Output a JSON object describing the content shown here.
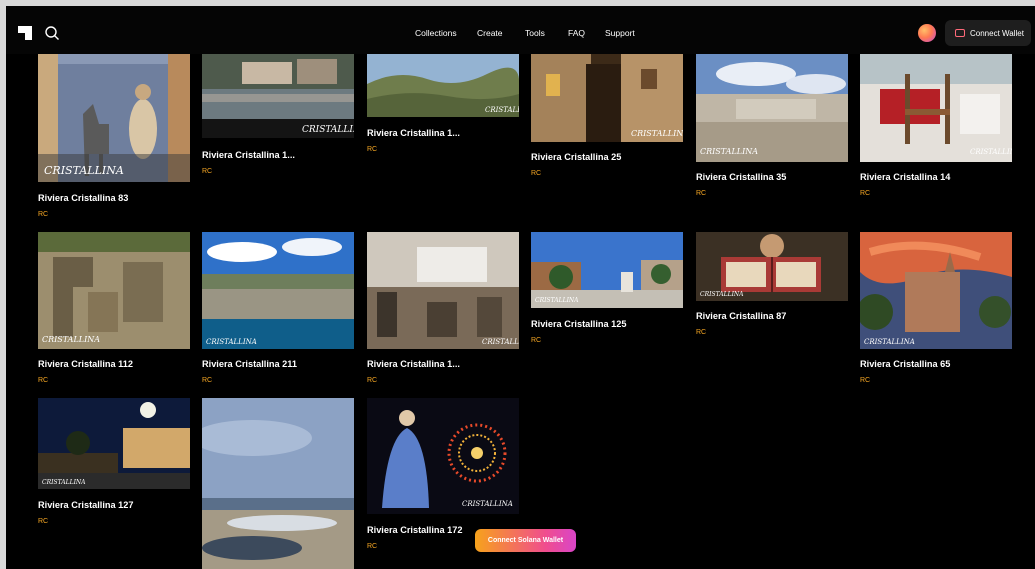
{
  "nav": {
    "links": [
      "Collections",
      "Create",
      "Tools",
      "FAQ",
      "Support"
    ],
    "connect_wallet": "Connect Wallet"
  },
  "watermark": "CRISTALLINA",
  "cards": [
    {
      "title": "Riviera Cristallina 83",
      "sub": "RC"
    },
    {
      "title": "Riviera Cristallina 1...",
      "sub": "RC"
    },
    {
      "title": "Riviera Cristallina 1...",
      "sub": "RC"
    },
    {
      "title": "Riviera Cristallina 25",
      "sub": "RC"
    },
    {
      "title": "Riviera Cristallina 35",
      "sub": "RC"
    },
    {
      "title": "Riviera Cristallina 14",
      "sub": "RC"
    },
    {
      "title": "Riviera Cristallina 112",
      "sub": "RC"
    },
    {
      "title": "Riviera Cristallina 211",
      "sub": "RC"
    },
    {
      "title": "Riviera Cristallina 1...",
      "sub": "RC"
    },
    {
      "title": "Riviera Cristallina 125",
      "sub": "RC"
    },
    {
      "title": "Riviera Cristallina 87",
      "sub": "RC"
    },
    {
      "title": "Riviera Cristallina 65",
      "sub": "RC"
    },
    {
      "title": "Riviera Cristallina 127",
      "sub": "RC"
    },
    {
      "title": "",
      "sub": ""
    },
    {
      "title": "Riviera Cristallina 172",
      "sub": "RC"
    }
  ],
  "cta": "Connect Solana Wallet",
  "colors": {
    "accent": "#f5a623",
    "cta_start": "#f7a21b",
    "cta_end": "#d945c8"
  }
}
